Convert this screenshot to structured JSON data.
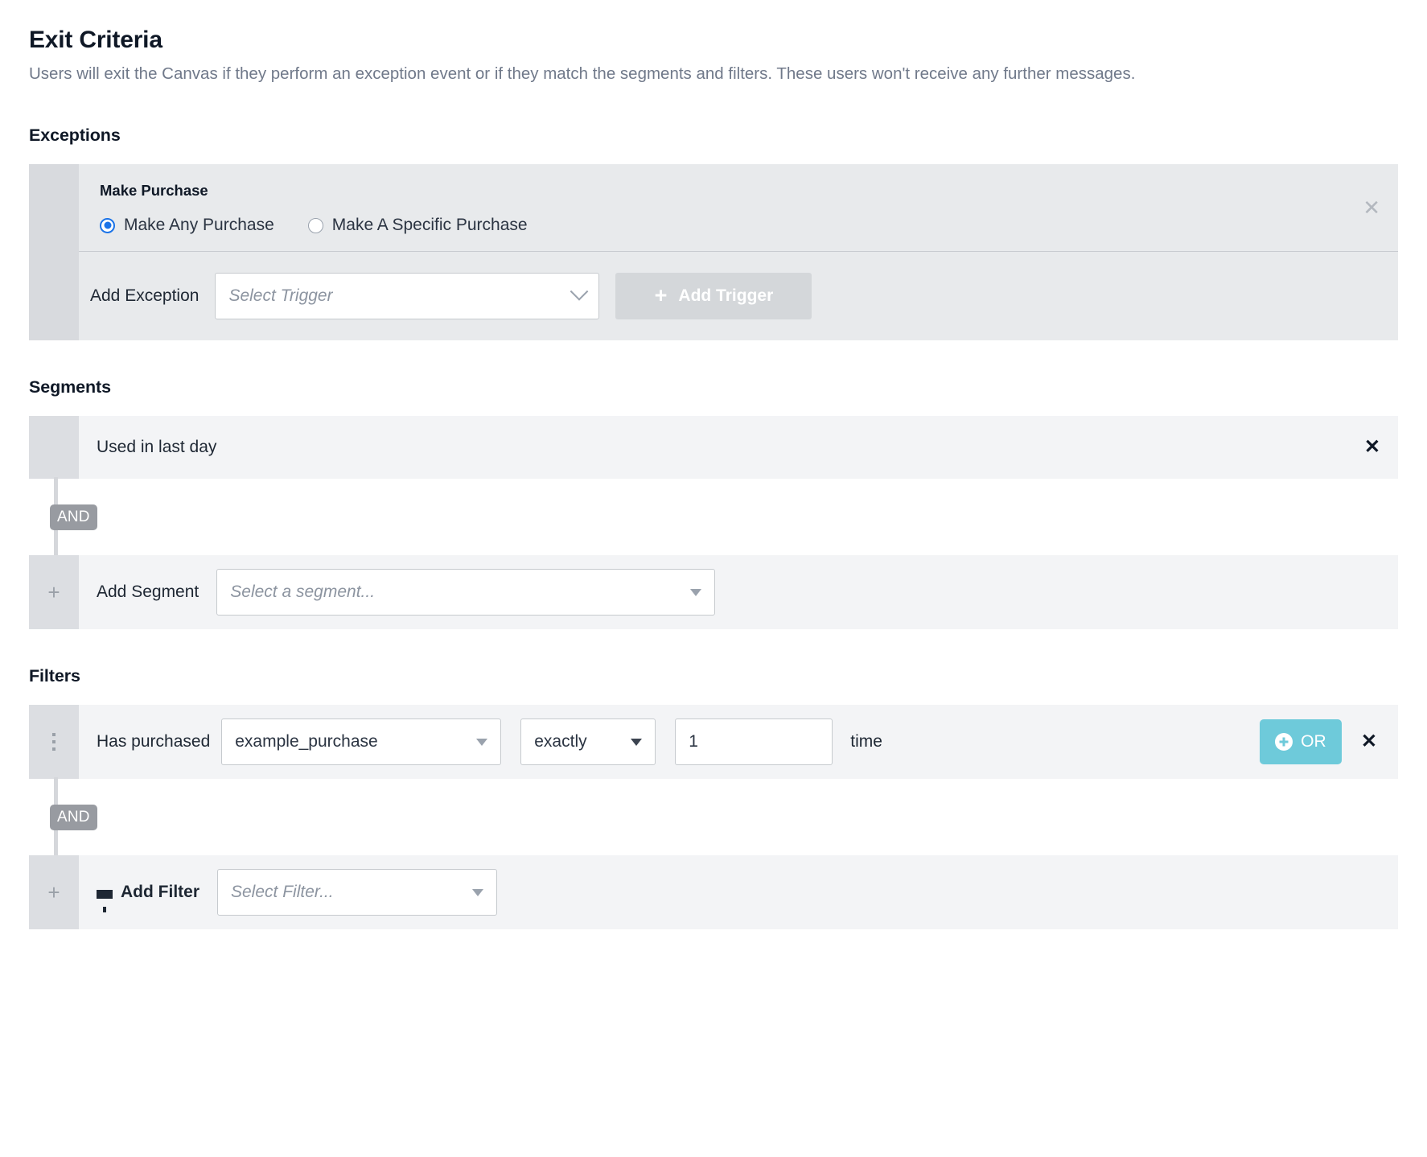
{
  "page": {
    "title": "Exit Criteria",
    "description": "Users will exit the Canvas if they perform an exception event or if they match the segments and filters. These users won't receive any further messages."
  },
  "exceptions": {
    "heading": "Exceptions",
    "card": {
      "name": "Make Purchase",
      "radio_options": [
        {
          "label": "Make Any Purchase",
          "selected": true
        },
        {
          "label": "Make A Specific Purchase",
          "selected": false
        }
      ],
      "remove_icon": "close-icon",
      "add_exception_label": "Add Exception",
      "trigger_select_placeholder": "Select Trigger",
      "add_trigger_button": "Add Trigger",
      "add_trigger_icon": "plus-icon",
      "add_trigger_disabled": true
    }
  },
  "segments": {
    "heading": "Segments",
    "existing": [
      {
        "name": "Used in last day",
        "remove_icon": "close-icon"
      }
    ],
    "connector_label": "AND",
    "add_row": {
      "gutter_icon": "plus-icon",
      "label": "Add Segment",
      "select_placeholder": "Select a segment...",
      "chevron_icon": "chevron-down-icon"
    }
  },
  "filters": {
    "heading": "Filters",
    "rows": [
      {
        "drag_icon": "drag-handle-icon",
        "label": "Has purchased",
        "event": "example_purchase",
        "comparator": "exactly",
        "count": "1",
        "unit": "time",
        "or_button": "OR",
        "or_icon": "circle-plus-icon",
        "remove_icon": "close-icon"
      }
    ],
    "connector_label": "AND",
    "add_row": {
      "gutter_icon": "plus-icon",
      "filter_icon": "funnel-icon",
      "label": "Add Filter",
      "select_placeholder": "Select Filter...",
      "chevron_icon": "chevron-down-icon"
    }
  },
  "colors": {
    "accent_teal": "#6ecada",
    "radio_blue": "#1a73e8",
    "card_gray": "#e8eaec",
    "row_gray": "#f3f4f6",
    "gutter_gray": "#d8dade",
    "badge_gray": "#989ba1",
    "disabled_button": "#d4d7da"
  }
}
